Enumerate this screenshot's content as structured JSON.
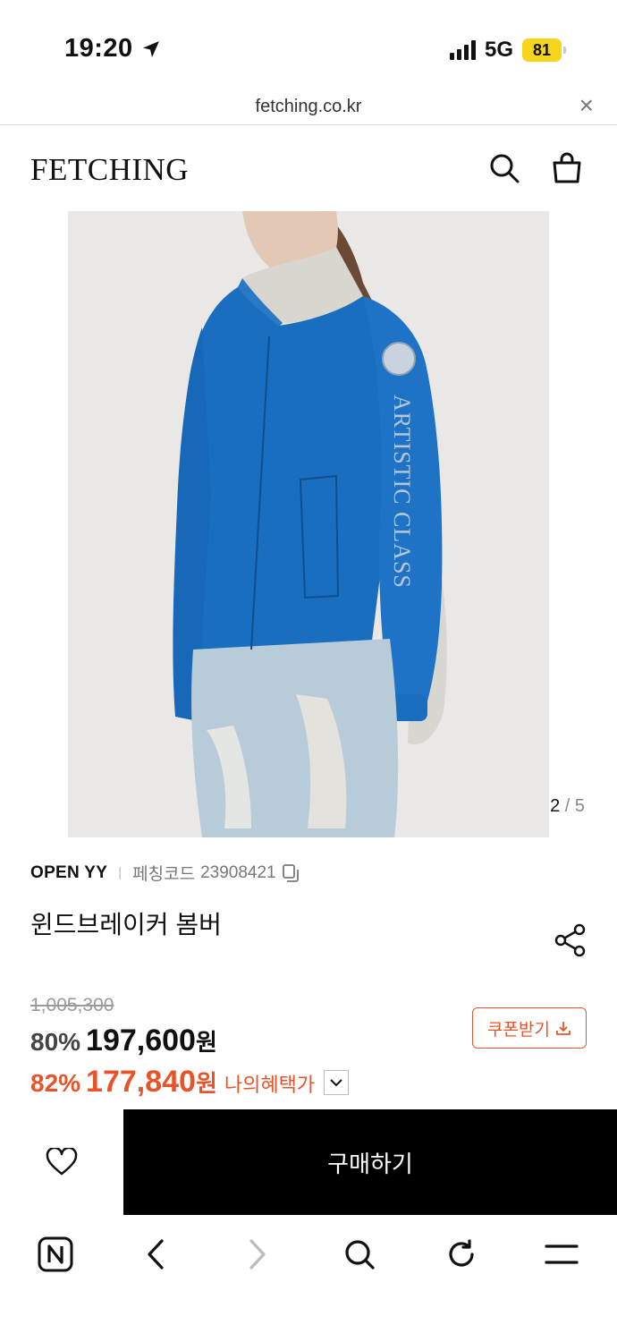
{
  "status_bar": {
    "time": "19:20",
    "network": "5G",
    "battery": "81"
  },
  "url_bar": {
    "url": "fetching.co.kr",
    "close_glyph": "×"
  },
  "header": {
    "logo": "FETCHING",
    "icons": [
      "search-icon",
      "shopping-bag-icon"
    ]
  },
  "gallery": {
    "current": "2",
    "separator": "/",
    "total": "5",
    "sleeve_text": "ARTISTIC CLASS"
  },
  "product": {
    "brand": "OPEN YY",
    "divider": "|",
    "code_label": "페칭코드",
    "code_value": "23908421",
    "name": "윈드브레이커 봄버",
    "original_price": "1,005,300",
    "discount_rate": "80%",
    "price": "197,600",
    "currency": "원",
    "benefit_rate": "82%",
    "benefit_price": "177,840",
    "benefit_label": "나의혜택가",
    "coupon_label": "쿠폰받기"
  },
  "buy_bar": {
    "buy_label": "구매하기"
  },
  "colors": {
    "accent": "#e8542a",
    "jacket": "#1a6ec0",
    "battery": "#f7d51c"
  },
  "toolbar": {
    "icons": [
      "naver-icon",
      "back-icon",
      "forward-icon",
      "search-icon",
      "reload-icon",
      "menu-icon"
    ]
  }
}
